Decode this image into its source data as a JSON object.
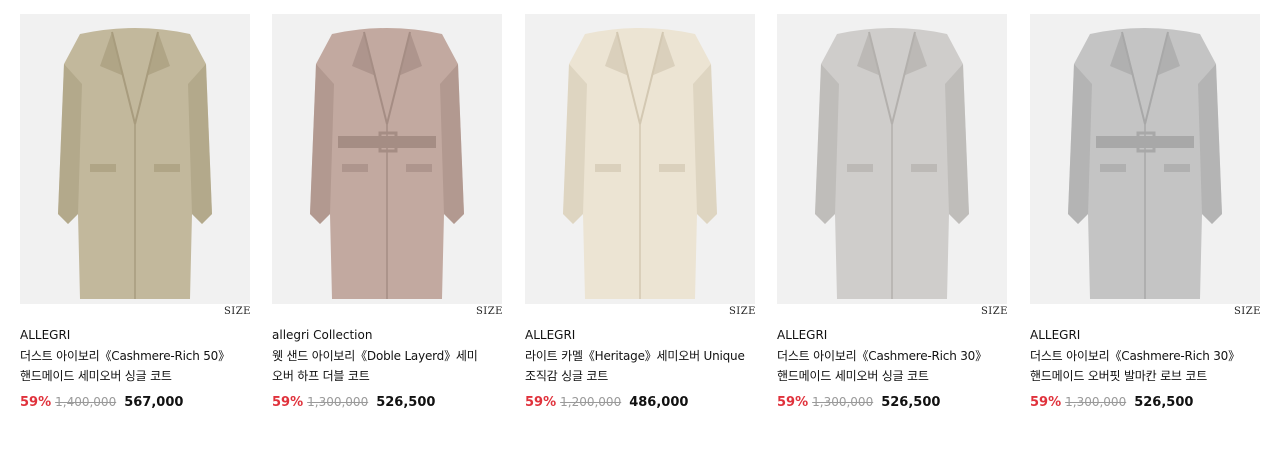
{
  "ui": {
    "size_label": "SIZE"
  },
  "products": [
    {
      "brand": "ALLEGRI",
      "name": "더스트 아이보리《Cashmere-Rich 50》\n핸드메이드 세미오버 싱글 코트",
      "discount": "59%",
      "original_price": "1,400,000",
      "price": "567,000",
      "coat_color": "#c2b89c",
      "coat_dark": "#a89c7e",
      "belt": false
    },
    {
      "brand": "allegri Collection",
      "name": "웻 샌드 아이보리《Doble Layerd》세미\n오버 하프 더블 코트",
      "discount": "59%",
      "original_price": "1,300,000",
      "price": "526,500",
      "coat_color": "#c2a9a0",
      "coat_dark": "#a58d84",
      "belt": true
    },
    {
      "brand": "ALLEGRI",
      "name": "라이트 카멜《Heritage》세미오버 Unique\n조직감 싱글 코트",
      "discount": "59%",
      "original_price": "1,200,000",
      "price": "486,000",
      "coat_color": "#ece4d3",
      "coat_dark": "#d3c8b2",
      "belt": false
    },
    {
      "brand": "ALLEGRI",
      "name": "더스트 아이보리《Cashmere-Rich 30》\n핸드메이드 세미오버 싱글 코트",
      "discount": "59%",
      "original_price": "1,300,000",
      "price": "526,500",
      "coat_color": "#cfcdcb",
      "coat_dark": "#b3b0ad",
      "belt": false
    },
    {
      "brand": "ALLEGRI",
      "name": "더스트 아이보리《Cashmere-Rich 30》\n핸드메이드 오버핏 발마칸 로브 코트",
      "discount": "59%",
      "original_price": "1,300,000",
      "price": "526,500",
      "coat_color": "#c4c4c4",
      "coat_dark": "#a8a8a8",
      "belt": true
    }
  ]
}
